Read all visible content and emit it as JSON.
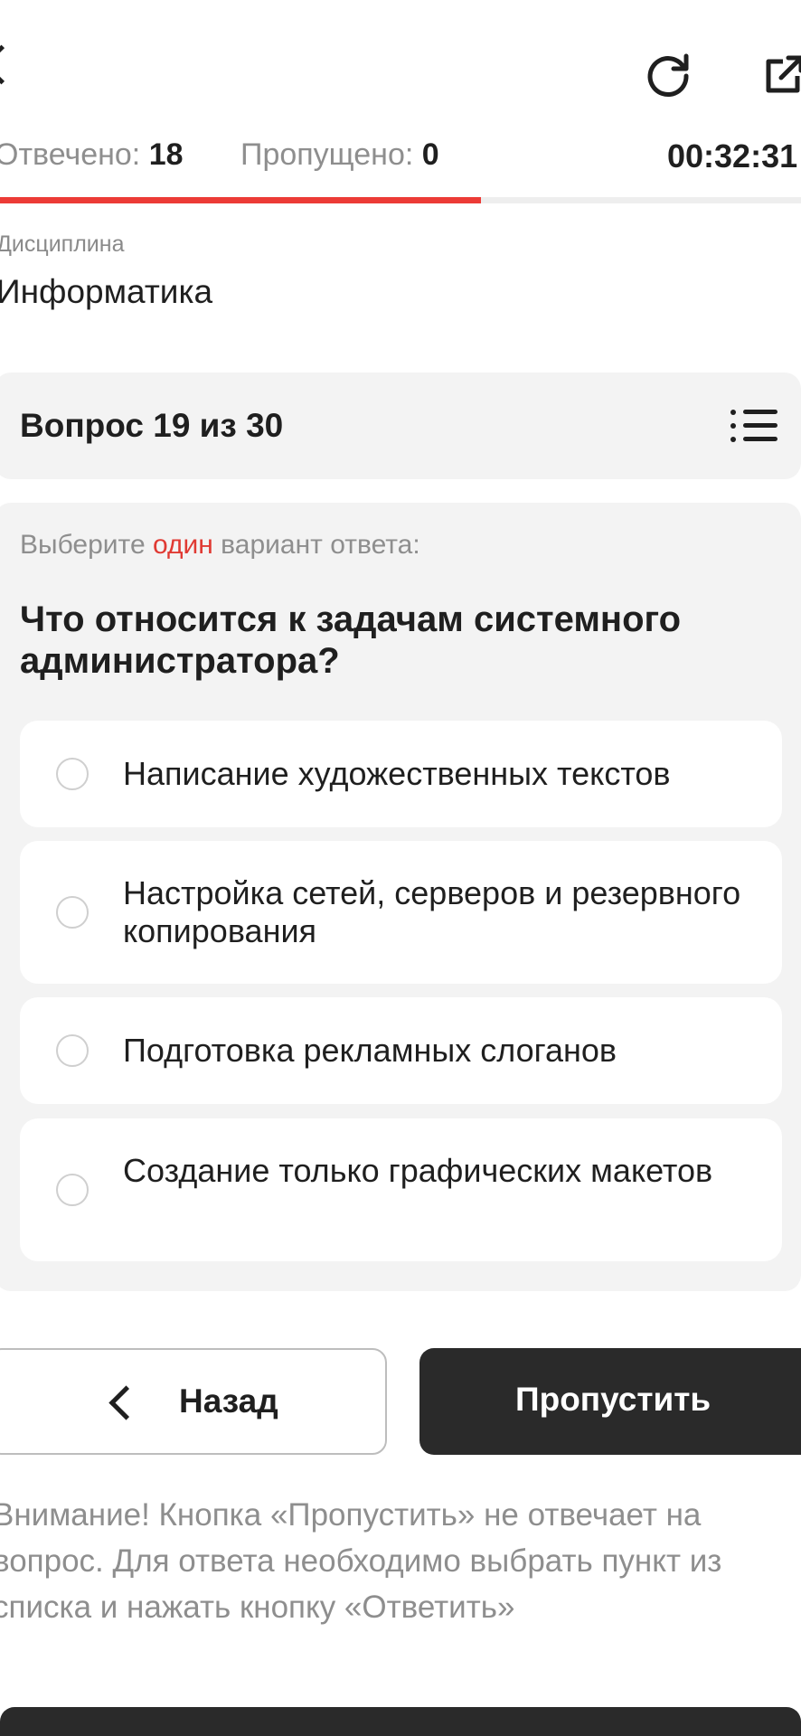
{
  "header": {
    "back_icon": "back-arrow-icon",
    "reload_icon": "reload-icon",
    "open_external_icon": "open-external-icon"
  },
  "stats": {
    "answered_label": "Отвечено:",
    "answered_value": "18",
    "skipped_label": "Пропущено:",
    "skipped_value": "0",
    "timer": "00:32:31"
  },
  "progress": {
    "fraction": 0.6,
    "fill_color": "#ec3b36",
    "track_color": "#eeeeee"
  },
  "discipline": {
    "label": "Дисциплина",
    "name": "Информатика"
  },
  "question_header": {
    "counter": "Вопрос 19 из 30",
    "list_icon": "list-icon"
  },
  "question": {
    "instruction_before": "Выберите ",
    "instruction_accent": "один",
    "instruction_after": " вариант ответа:",
    "accent_color": "#e03a33",
    "text": "Что относится к задачам системного администратора?",
    "options": [
      {
        "label": "Написание художественных текстов"
      },
      {
        "label": "Настройка сетей, серверов и резервного копирования"
      },
      {
        "label": "Подготовка рекламных слоганов"
      },
      {
        "label": "Создание только графических макетов"
      }
    ]
  },
  "buttons": {
    "back_label": "Назад",
    "skip_label": "Пропустить"
  },
  "warning": "Внимание! Кнопка «Пропустить» не отвечает на вопрос. Для ответа необходимо выбрать пункт из списка и нажать кнопку «Ответить»"
}
